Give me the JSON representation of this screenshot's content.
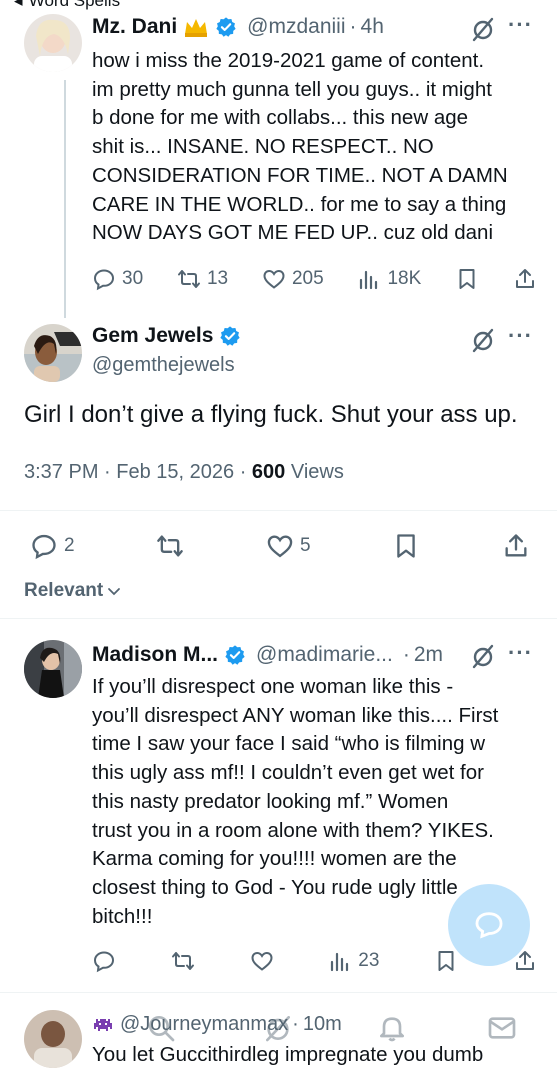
{
  "top_cut": {
    "label": "Word Spells"
  },
  "colors": {
    "accent": "#1d9bf0",
    "muted": "#536471",
    "text": "#0f1419"
  },
  "tweets": [
    {
      "name": "Mz. Dani",
      "handle": "@mzdaniii",
      "time": "4h",
      "lines": [
        "how i miss the 2019-2021 game of content.",
        "im pretty much gunna tell you guys.. it might",
        "b done for me with collabs... this new age",
        "shit is... INSANE. NO RESPECT.. NO",
        "CONSIDERATION FOR TIME.. NOT A DAMN",
        "CARE IN THE WORLD.. for me to say a thing",
        "NOW DAYS GOT ME FED UP.. cuz old dani"
      ],
      "replies": "30",
      "reposts": "13",
      "likes": "205",
      "views": "18K"
    }
  ],
  "main_tweet": {
    "name": "Gem Jewels",
    "handle": "@gemthejewels",
    "text": "Girl I don’t give a flying fuck. Shut your ass up.",
    "time": "3:37 PM",
    "date": "Feb 15, 2026",
    "views_count": "600",
    "views_label": "Views",
    "replies": "2",
    "likes": "5"
  },
  "sort": {
    "label": "Relevant"
  },
  "replies": [
    {
      "name": "Madison M...",
      "handle": "@madimarie...",
      "time": "2m",
      "lines": [
        "If you’ll disrespect one woman like this -",
        "you’ll disrespect ANY woman like this.... First",
        "time I saw your face I said “who is filming w",
        "this ugly ass mf!! I couldn’t even get wet for",
        "this nasty predator looking mf.”  Women",
        "trust you in a room alone with them? YIKES.",
        "Karma coming for you!!!! women are the",
        "closest thing to God - You rude ugly little",
        "bitch!!!"
      ],
      "views": "23"
    },
    {
      "handle": "@Journeymanmax",
      "time": "10m",
      "text": "You let Guccithirdleg impregnate you dumb"
    }
  ]
}
